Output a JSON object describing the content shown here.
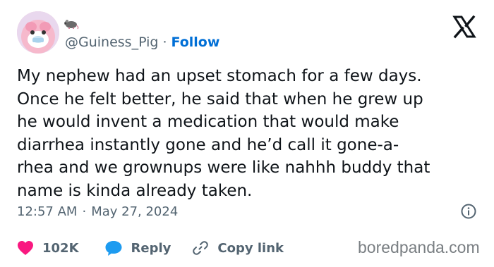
{
  "tweet": {
    "handle": "@Guiness_Pig",
    "separator": "·",
    "follow_label": "Follow",
    "text_lines": [
      "My nephew had an upset stomach for a few days.",
      "Once he felt better, he said that when he grew up",
      "he would invent a medication that would make",
      "diarrhea instantly gone and he’d call it gone-a-",
      "rhea and we grownups were like nahhh buddy that",
      "name is kinda already taken."
    ],
    "time": "12:57 AM",
    "date_separator": "·",
    "date": "May 27, 2024"
  },
  "actions": {
    "like_count": "102K",
    "reply_label": "Reply",
    "copy_link_label": "Copy link"
  },
  "watermark": "boredpanda.com",
  "icons": {
    "platform": "x-logo-icon",
    "name_emoji": "rat-emoji-icon",
    "info": "info-icon",
    "like": "heart-icon",
    "reply": "speech-bubble-icon",
    "copy": "link-icon"
  },
  "colors": {
    "heart": "#f91880",
    "reply": "#1d9bf0",
    "follow": "#006fd6",
    "muted": "#536471"
  }
}
